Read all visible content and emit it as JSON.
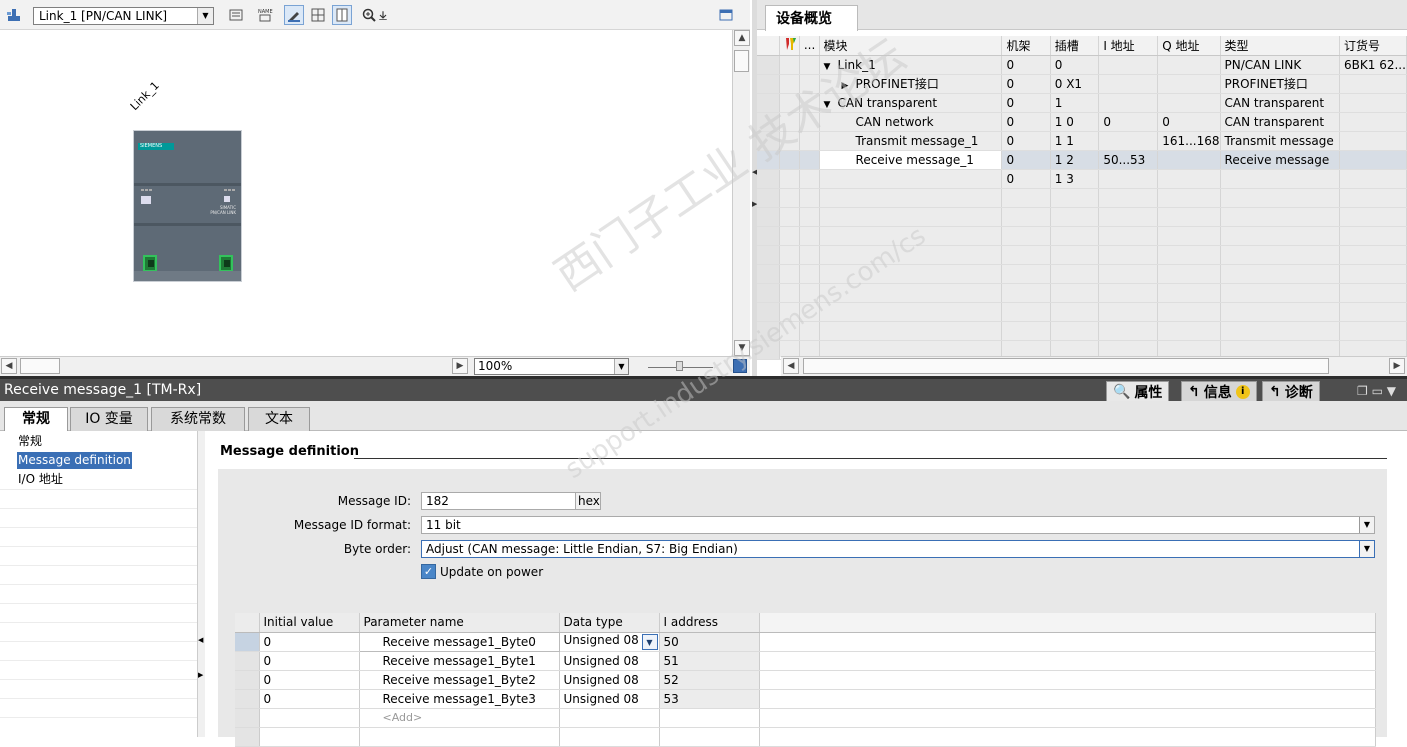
{
  "toolbar": {
    "device_select": "Link_1 [PN/CAN LINK]"
  },
  "canvas": {
    "device_label": "Link_1",
    "device_brand": "SIEMENS",
    "device_model_line1": "SIMATIC",
    "device_model_line2": "PN/CAN LINK",
    "zoom": "100%"
  },
  "overview": {
    "tab": "设备概览",
    "headers": [
      "",
      "...",
      "模块",
      "机架",
      "插槽",
      "I 地址",
      "Q 地址",
      "类型",
      "订货号"
    ],
    "rows": [
      {
        "expand": "▼",
        "indent": 0,
        "module": "Link_1",
        "rack": "0",
        "slot": "0",
        "i": "",
        "q": "",
        "type": "PN/CAN LINK",
        "order": "6BK1 62..."
      },
      {
        "expand": "▶",
        "indent": 1,
        "module": "PROFINET接口",
        "rack": "0",
        "slot": "0 X1",
        "i": "",
        "q": "",
        "type": "PROFINET接口",
        "order": ""
      },
      {
        "expand": "▼",
        "indent": 0,
        "module": "CAN transparent",
        "rack": "0",
        "slot": "1",
        "i": "",
        "q": "",
        "type": "CAN transparent",
        "order": ""
      },
      {
        "expand": "",
        "indent": 1,
        "module": "CAN network",
        "rack": "0",
        "slot": "1 0",
        "i": "0",
        "q": "0",
        "type": "CAN transparent",
        "order": ""
      },
      {
        "expand": "",
        "indent": 1,
        "module": "Transmit message_1",
        "rack": "0",
        "slot": "1 1",
        "i": "",
        "q": "161...168",
        "type": "Transmit message",
        "order": ""
      },
      {
        "expand": "",
        "indent": 1,
        "module": "Receive message_1",
        "rack": "0",
        "slot": "1 2",
        "i": "50...53",
        "q": "",
        "type": "Receive message",
        "order": ""
      },
      {
        "expand": "",
        "indent": 0,
        "module": "",
        "rack": "0",
        "slot": "1 3",
        "i": "",
        "q": "",
        "type": "",
        "order": ""
      }
    ]
  },
  "panel": {
    "title": "Receive message_1 [TM-Rx]",
    "right_tabs": [
      "属性",
      "信息",
      "诊断"
    ],
    "tabs": [
      "常规",
      "IO 变量",
      "系统常数",
      "文本"
    ],
    "nav": [
      "常规",
      "Message definition",
      "I/O 地址"
    ],
    "section_title": "Message definition",
    "fields": {
      "message_id_label": "Message ID:",
      "message_id_value": "182",
      "message_id_unit": "hex",
      "format_label": "Message ID format:",
      "format_value": "11 bit",
      "byte_order_label": "Byte order:",
      "byte_order_value": "Adjust (CAN message: Little Endian, S7: Big Endian)",
      "update_label": "Update on power"
    },
    "param_headers": [
      "Initial value",
      "Parameter name",
      "Data type",
      "I address"
    ],
    "params": [
      {
        "init": "0",
        "name": "Receive message1_Byte0",
        "type": "Unsigned 08",
        "addr": "50"
      },
      {
        "init": "0",
        "name": "Receive message1_Byte1",
        "type": "Unsigned 08",
        "addr": "51"
      },
      {
        "init": "0",
        "name": "Receive message1_Byte2",
        "type": "Unsigned 08",
        "addr": "52"
      },
      {
        "init": "0",
        "name": "Receive message1_Byte3",
        "type": "Unsigned 08",
        "addr": "53"
      }
    ],
    "add_label": "<Add>"
  },
  "watermark": {
    "line1": "西门子工业  技术论坛",
    "line2": "support.industry.siemens.com/cs"
  }
}
